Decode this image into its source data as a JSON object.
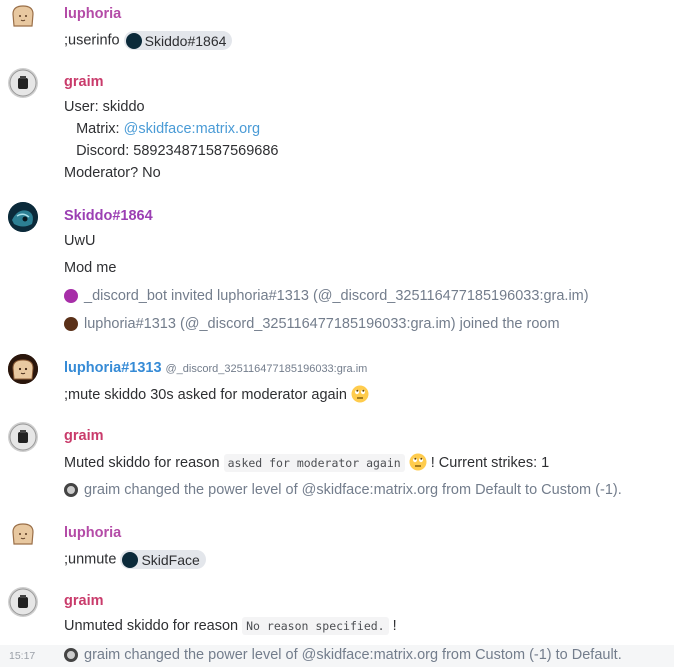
{
  "messages": [
    {
      "sender": "luphoria",
      "body_text": ";userinfo",
      "pill_label": "Skiddo#1864"
    },
    {
      "sender": "graim",
      "lines": [
        "User: skiddo",
        "   Matrix: ",
        "   Discord: 589234871587569686",
        "Moderator? No"
      ],
      "matrix_link": "@skidface:matrix.org"
    },
    {
      "sender": "Skiddo#1864",
      "lines": [
        "UwU",
        "Mod me"
      ]
    },
    {
      "sender": "luphoria#1313",
      "sender_id": "@_discord_325116477185196033:gra.im",
      "body_text": ";mute skiddo 30s asked for moderator again"
    },
    {
      "sender": "graim",
      "body_pre": "Muted skiddo for reason",
      "body_code": "asked for moderator again",
      "body_post": "! Current strikes: 1"
    },
    {
      "sender": "luphoria",
      "body_text": ";unmute",
      "pill_label": "SkidFace"
    },
    {
      "sender": "graim",
      "body_pre": "Unmuted skiddo for reason",
      "body_code": "No reason specified.",
      "body_post": "!"
    }
  ],
  "state_events": [
    "_discord_bot invited luphoria#1313 (@_discord_325116477185196033:gra.im)",
    "luphoria#1313 (@_discord_325116477185196033:gra.im) joined the room",
    "graim changed the power level of @skidface:matrix.org from Default to Custom (-1).",
    "graim changed the power level of @skidface:matrix.org from Custom (-1) to Default."
  ],
  "timestamp": "15:17",
  "colors": {
    "sender_pink": "#b44ba7",
    "sender_red": "#c93b6b",
    "sender_blue": "#368bd6",
    "link": "#4a9bd6",
    "muted": "#737d8c"
  }
}
